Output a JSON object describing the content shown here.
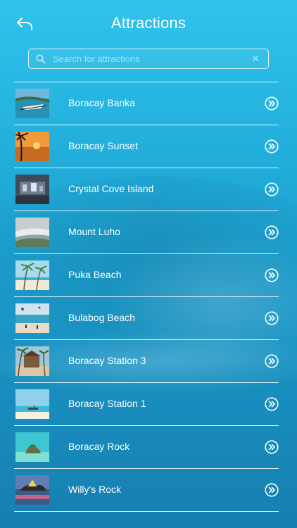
{
  "header": {
    "title": "Attractions"
  },
  "search": {
    "placeholder": "Search for attractions",
    "value": ""
  },
  "attractions": [
    {
      "name": "Boracay Banka"
    },
    {
      "name": "Boracay Sunset"
    },
    {
      "name": "Crystal Cove Island"
    },
    {
      "name": "Mount Luho"
    },
    {
      "name": "Puka Beach"
    },
    {
      "name": "Bulabog Beach"
    },
    {
      "name": "Boracay Station 3"
    },
    {
      "name": "Boracay Station 1"
    },
    {
      "name": "Boracay Rock"
    },
    {
      "name": "Willy's Rock"
    }
  ],
  "icons": {
    "back": "back-arrow-icon",
    "search": "search-icon",
    "clear": "clear-icon",
    "row_action": "double-chevron-right-icon"
  },
  "colors": {
    "background_top": "#2fc3ec",
    "background_bottom": "#167fb0",
    "text": "#ffffff"
  }
}
